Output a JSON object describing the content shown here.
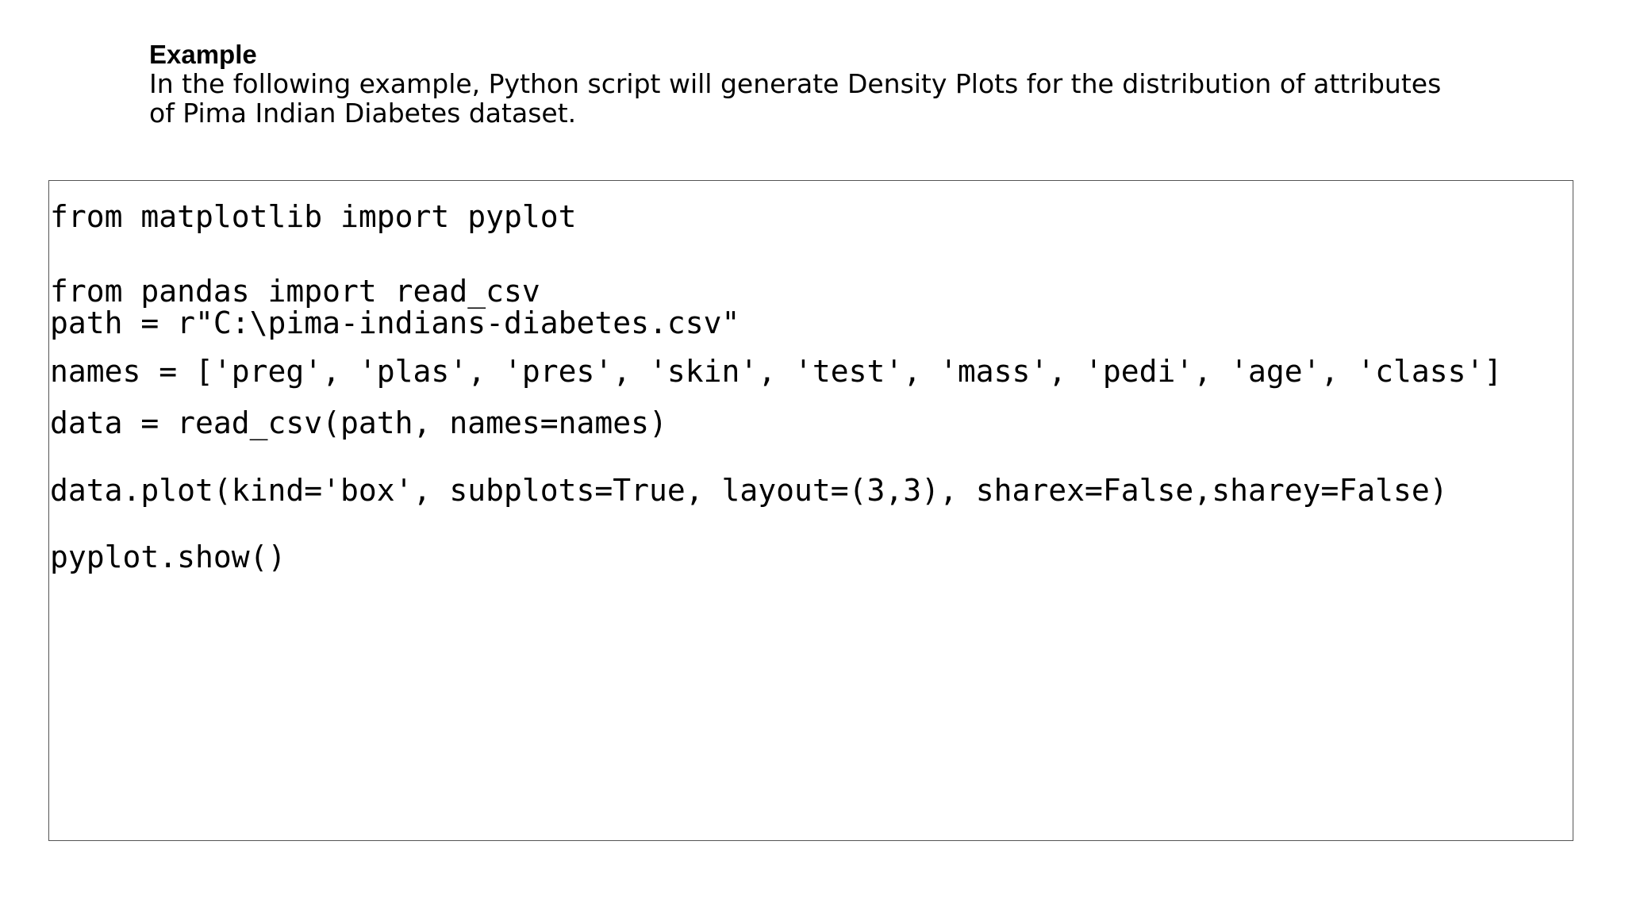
{
  "example": {
    "heading": "Example",
    "description_lines": [
      "In the following example, Python script will generate Density Plots for the distribution of attributes",
      "of Pima Indian Diabetes dataset."
    ]
  },
  "code": {
    "lines": [
      "from matplotlib import pyplot",
      "from pandas import read_csv",
      "path = r\"C:\\pima-indians-diabetes.csv\"",
      "names = ['preg', 'plas', 'pres', 'skin', 'test', 'mass', 'pedi', 'age', 'class']",
      "data = read_csv(path, names=names)",
      "data.plot(kind='box', subplots=True, layout=(3,3), sharex=False,sharey=False)",
      "pyplot.show()"
    ]
  }
}
